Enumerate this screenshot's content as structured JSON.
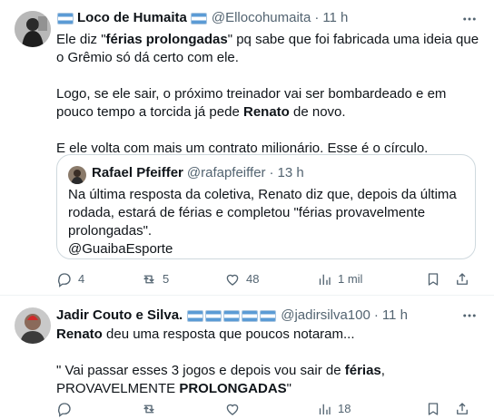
{
  "tweet1": {
    "author_name": "Loco de Humaita",
    "handle": "@Ellocohumaita",
    "time": "11 h",
    "p1_a": "Ele diz \"",
    "p1_b": "férias prolongadas",
    "p1_c": "\" pq sabe que foi fabricada uma ideia que o Grêmio só dá certo com ele.",
    "p2_a": "Logo, se ele sair, o próximo treinador vai ser bombardeado e em pouco tempo a torcida já pede ",
    "p2_b": "Renato",
    "p2_c": " de novo.",
    "p3": "E ele volta com mais um contrato milionário. Esse é o círculo.",
    "quote": {
      "author_name": "Rafael Pfeiffer",
      "handle": "@rafapfeiffer",
      "time": "13 h",
      "text": "Na última resposta da coletiva, Renato diz que, depois da última rodada, estará de férias e completou \"férias provavelmente prolongadas\".",
      "mention": "@GuaibaEsporte"
    },
    "replies": "4",
    "retweets": "5",
    "likes": "48",
    "views": "1 mil"
  },
  "tweet2": {
    "author_name": "Jadir Couto e Silva.",
    "handle": "@jadirsilva100",
    "time": "11 h",
    "p1_a": "Renato",
    "p1_b": " deu uma resposta que poucos notaram...",
    "p2_a": "\" Vai passar esses 3 jogos e depois vou sair de ",
    "p2_b": "férias",
    "p2_c": ", PROVAVELMENTE ",
    "p2_d": "PROLONGADAS",
    "p2_e": "\"",
    "views": "18"
  },
  "icons": {
    "more": "more-horizontal-icon",
    "reply": "reply-icon",
    "retweet": "retweet-icon",
    "like": "heart-icon",
    "views": "views-icon",
    "bookmark": "bookmark-icon",
    "share": "share-icon"
  },
  "colors": {
    "text": "#0f1419",
    "secondary": "#536471",
    "border": "#cfd9de",
    "divider": "#eff3f4",
    "flag_blue": "#5b9bd5"
  }
}
